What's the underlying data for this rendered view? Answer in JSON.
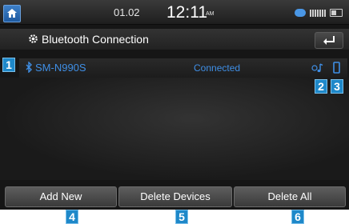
{
  "status_bar": {
    "date": "01.02",
    "time": "12:11",
    "ampm": "AM",
    "icons": [
      "bluetooth-audio-icon",
      "signal-icon",
      "battery-icon"
    ]
  },
  "header": {
    "title": "Bluetooth Connection",
    "icon": "gear-icon",
    "back_icon": "back-arrow-icon"
  },
  "device": {
    "name": "SM-N990S",
    "status": "Connected",
    "audio_icon": "bluetooth-audio-icon",
    "phone_icon": "phone-icon"
  },
  "buttons": {
    "add_new": "Add New",
    "delete_devices": "Delete Devices",
    "delete_all": "Delete All"
  },
  "markers": {
    "m1": "1",
    "m2": "2",
    "m3": "3",
    "m4": "4",
    "m5": "5",
    "m6": "6"
  },
  "colors": {
    "accent": "#3f8fe6",
    "marker": "#1e88c9"
  }
}
